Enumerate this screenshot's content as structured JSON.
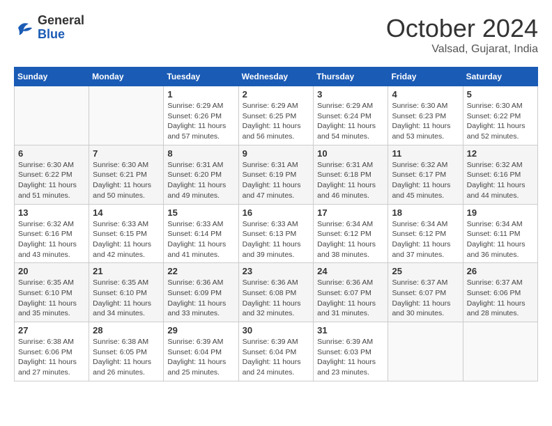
{
  "logo": {
    "general": "General",
    "blue": "Blue"
  },
  "title": "October 2024",
  "location": "Valsad, Gujarat, India",
  "days_header": [
    "Sunday",
    "Monday",
    "Tuesday",
    "Wednesday",
    "Thursday",
    "Friday",
    "Saturday"
  ],
  "weeks": [
    [
      {
        "day": "",
        "sunrise": "",
        "sunset": "",
        "daylight": ""
      },
      {
        "day": "",
        "sunrise": "",
        "sunset": "",
        "daylight": ""
      },
      {
        "day": "1",
        "sunrise": "Sunrise: 6:29 AM",
        "sunset": "Sunset: 6:26 PM",
        "daylight": "Daylight: 11 hours and 57 minutes."
      },
      {
        "day": "2",
        "sunrise": "Sunrise: 6:29 AM",
        "sunset": "Sunset: 6:25 PM",
        "daylight": "Daylight: 11 hours and 56 minutes."
      },
      {
        "day": "3",
        "sunrise": "Sunrise: 6:29 AM",
        "sunset": "Sunset: 6:24 PM",
        "daylight": "Daylight: 11 hours and 54 minutes."
      },
      {
        "day": "4",
        "sunrise": "Sunrise: 6:30 AM",
        "sunset": "Sunset: 6:23 PM",
        "daylight": "Daylight: 11 hours and 53 minutes."
      },
      {
        "day": "5",
        "sunrise": "Sunrise: 6:30 AM",
        "sunset": "Sunset: 6:22 PM",
        "daylight": "Daylight: 11 hours and 52 minutes."
      }
    ],
    [
      {
        "day": "6",
        "sunrise": "Sunrise: 6:30 AM",
        "sunset": "Sunset: 6:22 PM",
        "daylight": "Daylight: 11 hours and 51 minutes."
      },
      {
        "day": "7",
        "sunrise": "Sunrise: 6:30 AM",
        "sunset": "Sunset: 6:21 PM",
        "daylight": "Daylight: 11 hours and 50 minutes."
      },
      {
        "day": "8",
        "sunrise": "Sunrise: 6:31 AM",
        "sunset": "Sunset: 6:20 PM",
        "daylight": "Daylight: 11 hours and 49 minutes."
      },
      {
        "day": "9",
        "sunrise": "Sunrise: 6:31 AM",
        "sunset": "Sunset: 6:19 PM",
        "daylight": "Daylight: 11 hours and 47 minutes."
      },
      {
        "day": "10",
        "sunrise": "Sunrise: 6:31 AM",
        "sunset": "Sunset: 6:18 PM",
        "daylight": "Daylight: 11 hours and 46 minutes."
      },
      {
        "day": "11",
        "sunrise": "Sunrise: 6:32 AM",
        "sunset": "Sunset: 6:17 PM",
        "daylight": "Daylight: 11 hours and 45 minutes."
      },
      {
        "day": "12",
        "sunrise": "Sunrise: 6:32 AM",
        "sunset": "Sunset: 6:16 PM",
        "daylight": "Daylight: 11 hours and 44 minutes."
      }
    ],
    [
      {
        "day": "13",
        "sunrise": "Sunrise: 6:32 AM",
        "sunset": "Sunset: 6:16 PM",
        "daylight": "Daylight: 11 hours and 43 minutes."
      },
      {
        "day": "14",
        "sunrise": "Sunrise: 6:33 AM",
        "sunset": "Sunset: 6:15 PM",
        "daylight": "Daylight: 11 hours and 42 minutes."
      },
      {
        "day": "15",
        "sunrise": "Sunrise: 6:33 AM",
        "sunset": "Sunset: 6:14 PM",
        "daylight": "Daylight: 11 hours and 41 minutes."
      },
      {
        "day": "16",
        "sunrise": "Sunrise: 6:33 AM",
        "sunset": "Sunset: 6:13 PM",
        "daylight": "Daylight: 11 hours and 39 minutes."
      },
      {
        "day": "17",
        "sunrise": "Sunrise: 6:34 AM",
        "sunset": "Sunset: 6:12 PM",
        "daylight": "Daylight: 11 hours and 38 minutes."
      },
      {
        "day": "18",
        "sunrise": "Sunrise: 6:34 AM",
        "sunset": "Sunset: 6:12 PM",
        "daylight": "Daylight: 11 hours and 37 minutes."
      },
      {
        "day": "19",
        "sunrise": "Sunrise: 6:34 AM",
        "sunset": "Sunset: 6:11 PM",
        "daylight": "Daylight: 11 hours and 36 minutes."
      }
    ],
    [
      {
        "day": "20",
        "sunrise": "Sunrise: 6:35 AM",
        "sunset": "Sunset: 6:10 PM",
        "daylight": "Daylight: 11 hours and 35 minutes."
      },
      {
        "day": "21",
        "sunrise": "Sunrise: 6:35 AM",
        "sunset": "Sunset: 6:10 PM",
        "daylight": "Daylight: 11 hours and 34 minutes."
      },
      {
        "day": "22",
        "sunrise": "Sunrise: 6:36 AM",
        "sunset": "Sunset: 6:09 PM",
        "daylight": "Daylight: 11 hours and 33 minutes."
      },
      {
        "day": "23",
        "sunrise": "Sunrise: 6:36 AM",
        "sunset": "Sunset: 6:08 PM",
        "daylight": "Daylight: 11 hours and 32 minutes."
      },
      {
        "day": "24",
        "sunrise": "Sunrise: 6:36 AM",
        "sunset": "Sunset: 6:07 PM",
        "daylight": "Daylight: 11 hours and 31 minutes."
      },
      {
        "day": "25",
        "sunrise": "Sunrise: 6:37 AM",
        "sunset": "Sunset: 6:07 PM",
        "daylight": "Daylight: 11 hours and 30 minutes."
      },
      {
        "day": "26",
        "sunrise": "Sunrise: 6:37 AM",
        "sunset": "Sunset: 6:06 PM",
        "daylight": "Daylight: 11 hours and 28 minutes."
      }
    ],
    [
      {
        "day": "27",
        "sunrise": "Sunrise: 6:38 AM",
        "sunset": "Sunset: 6:06 PM",
        "daylight": "Daylight: 11 hours and 27 minutes."
      },
      {
        "day": "28",
        "sunrise": "Sunrise: 6:38 AM",
        "sunset": "Sunset: 6:05 PM",
        "daylight": "Daylight: 11 hours and 26 minutes."
      },
      {
        "day": "29",
        "sunrise": "Sunrise: 6:39 AM",
        "sunset": "Sunset: 6:04 PM",
        "daylight": "Daylight: 11 hours and 25 minutes."
      },
      {
        "day": "30",
        "sunrise": "Sunrise: 6:39 AM",
        "sunset": "Sunset: 6:04 PM",
        "daylight": "Daylight: 11 hours and 24 minutes."
      },
      {
        "day": "31",
        "sunrise": "Sunrise: 6:39 AM",
        "sunset": "Sunset: 6:03 PM",
        "daylight": "Daylight: 11 hours and 23 minutes."
      },
      {
        "day": "",
        "sunrise": "",
        "sunset": "",
        "daylight": ""
      },
      {
        "day": "",
        "sunrise": "",
        "sunset": "",
        "daylight": ""
      }
    ]
  ]
}
